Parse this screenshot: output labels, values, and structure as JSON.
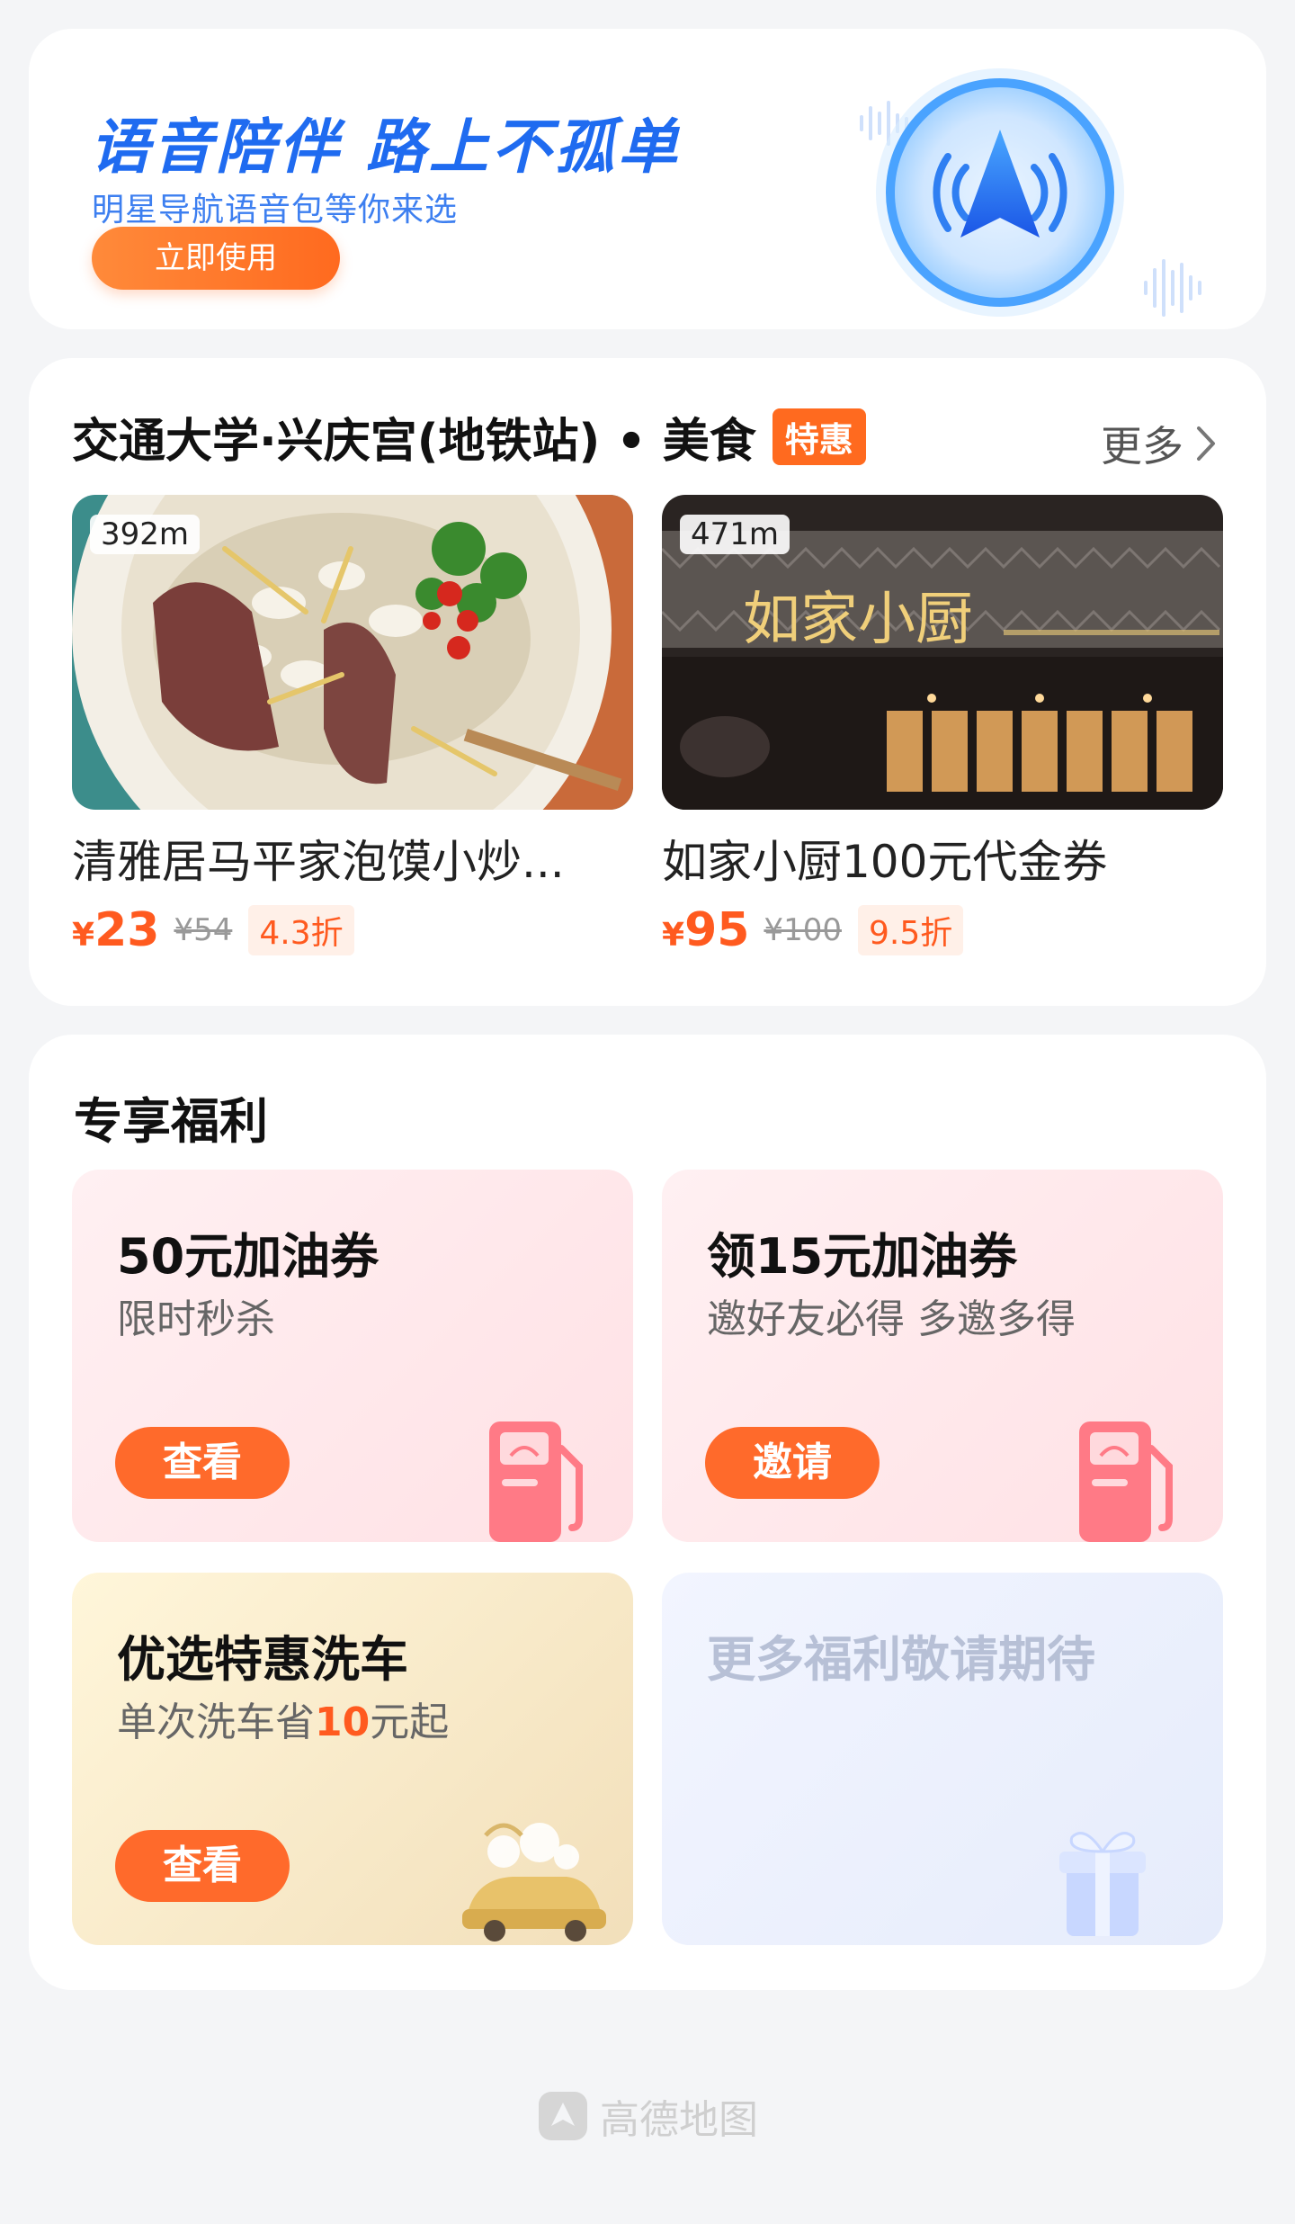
{
  "banner": {
    "title": "语音陪伴 路上不孤单",
    "subtitle": "明星导航语音包等你来选",
    "button": "立即使用"
  },
  "food": {
    "title": "交通大学·兴庆宫(地铁站) • 美食",
    "tag": "特惠",
    "more": "更多",
    "deals": [
      {
        "distance": "392m",
        "name": "清雅居马平家泡馍小炒...",
        "price_symbol": "¥",
        "price": "23",
        "original": "¥54",
        "discount": "4.3折"
      },
      {
        "distance": "471m",
        "name": "如家小厨100元代金券",
        "price_symbol": "¥",
        "price": "95",
        "original": "¥100",
        "discount": "9.5折",
        "sign_text": "如家小厨"
      }
    ]
  },
  "benefits": {
    "title": "专享福利",
    "cards": [
      {
        "title": "50元加油券",
        "subtitle": "限时秒杀",
        "button": "查看"
      },
      {
        "title": "领15元加油券",
        "subtitle": "邀好友必得 多邀多得",
        "button": "邀请"
      },
      {
        "title": "优选特惠洗车",
        "subtitle_pre": "单次洗车省",
        "subtitle_hl": "10",
        "subtitle_post": "元起",
        "button": "查看"
      },
      {
        "title": "更多福利敬请期待"
      }
    ]
  },
  "footer": {
    "brand": "高德地图"
  },
  "colors": {
    "accent": "#ff6a1f",
    "brand_blue": "#1f6bf0"
  }
}
